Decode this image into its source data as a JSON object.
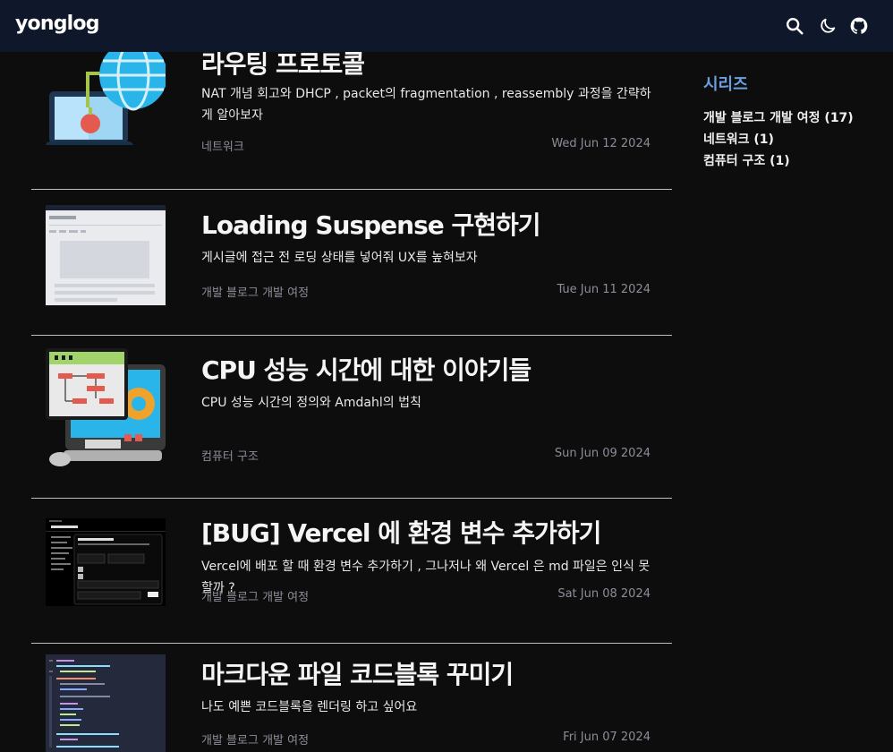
{
  "header": {
    "logo": "yonglog",
    "icons": [
      "search-icon",
      "moon-icon",
      "github-icon"
    ]
  },
  "posts": [
    {
      "title": "라우팅 프로토콜",
      "description": "NAT 개념 회고와 DHCP , packet의 fragmentation , reassembly 과정을 간략하게 알아보자",
      "category": "네트워크",
      "date": "Wed Jun 12 2024",
      "thumbnail": "network-globe-laptop"
    },
    {
      "title": "Loading Suspense 구현하기",
      "description": "게시글에 접근 전 로딩 상태를 넣어줘 UX를 높혀보자",
      "category": "개발 블로그 개발 여정",
      "date": "Tue Jun 11 2024",
      "thumbnail": "blog-screenshot"
    },
    {
      "title": "CPU 성능 시간에 대한 이야기들",
      "description": "CPU 성능 시간의 정의와 Amdahl의 법칙",
      "category": "컴퓨터 구조",
      "date": "Sun Jun 09 2024",
      "thumbnail": "computer-flowchart"
    },
    {
      "title": "[BUG] Vercel 에 환경 변수 추가하기",
      "description": "Vercel에 배포 할 때 환경 변수 추가하기 , 그나저나 왜 Vercel 은 md 파일은 인식 못할까 ?",
      "category": "개발 블로그 개발 여정",
      "date": "Sat Jun 08 2024",
      "thumbnail": "vercel-settings-screenshot"
    },
    {
      "title": "마크다운 파일 코드블록 꾸미기",
      "description": "나도 예쁜 코드블록을 렌더링 하고 싶어요",
      "category": "개발 블로그 개발 여정",
      "date": "Fri Jun 07 2024",
      "thumbnail": "code-editor-screenshot"
    }
  ],
  "series": {
    "title": "시리즈",
    "items": [
      {
        "label": "개발 블로그 개발 여정 (17)"
      },
      {
        "label": "네트워크 (1)"
      },
      {
        "label": "컴퓨터 구조 (1)"
      }
    ]
  },
  "colors": {
    "background": "#0d0d0d",
    "header": "#0f172a",
    "accent": "#6aa0e0",
    "muted": "#8d8d99"
  }
}
